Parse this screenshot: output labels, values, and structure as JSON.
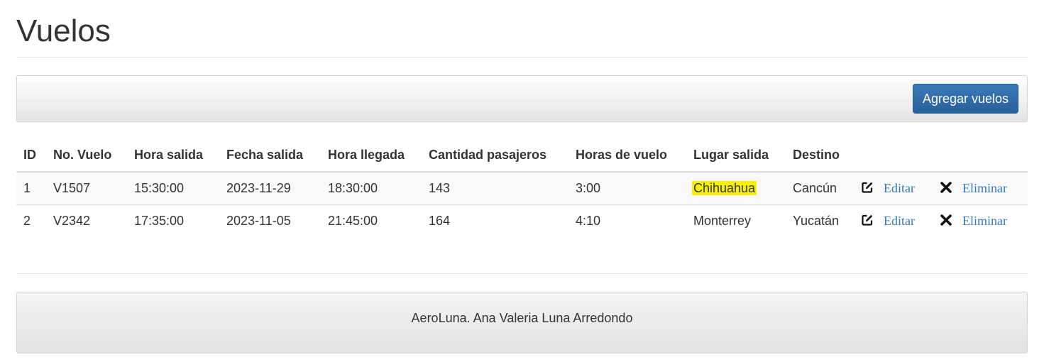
{
  "page": {
    "title": "Vuelos"
  },
  "toolbar": {
    "add_label": "Agregar vuelos"
  },
  "table": {
    "headers": [
      "ID",
      "No. Vuelo",
      "Hora salida",
      "Fecha salida",
      "Hora llegada",
      "Cantidad pasajeros",
      "Horas de vuelo",
      "Lugar salida",
      "Destino"
    ],
    "rows": [
      {
        "id": "1",
        "flight_no": "V1507",
        "dep_time": "15:30:00",
        "dep_date": "2023-11-29",
        "arr_time": "18:30:00",
        "passengers": "143",
        "flight_hours": "3:00",
        "origin": "Chihuahua",
        "destination": "Cancún"
      },
      {
        "id": "2",
        "flight_no": "V2342",
        "dep_time": "17:35:00",
        "dep_date": "2023-11-05",
        "arr_time": "21:45:00",
        "passengers": "164",
        "flight_hours": "4:10",
        "origin": "Monterrey",
        "destination": "Yucatán"
      }
    ],
    "actions": {
      "edit_label": "Editar",
      "delete_label": "Eliminar",
      "edit_icon": "edit-icon",
      "delete_icon": "close-icon"
    }
  },
  "footer": {
    "text": "AeroLuna. Ana Valeria Luna Arredondo"
  },
  "colors": {
    "primary": "#337ab7",
    "highlight": "#f7f200"
  }
}
